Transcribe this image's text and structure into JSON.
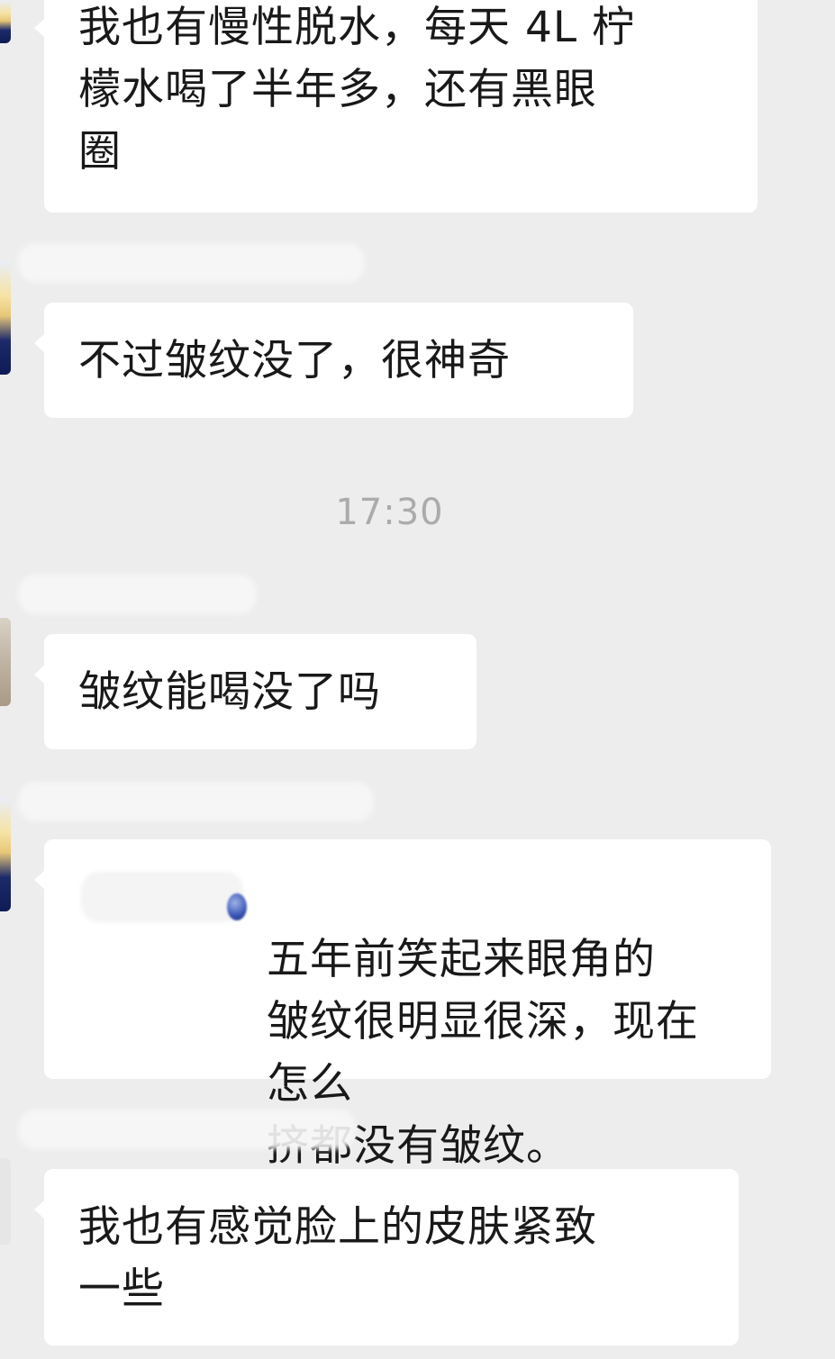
{
  "chat": {
    "messages": [
      {
        "text": "我也有慢性脱水，每天 4L 柠\n檬水喝了半年多，还有黑眼\n圈"
      },
      {
        "text": "不过皱纹没了，很神奇"
      },
      {
        "text": "皱纹能喝没了吗"
      },
      {
        "text": "五年前笑起来眼角的\n皱纹很明显很深，现在怎么\n挤都没有皱纹。"
      },
      {
        "text": "我也有感觉脸上的皮肤紧致\n一些"
      }
    ],
    "timestamp": "17:30"
  }
}
